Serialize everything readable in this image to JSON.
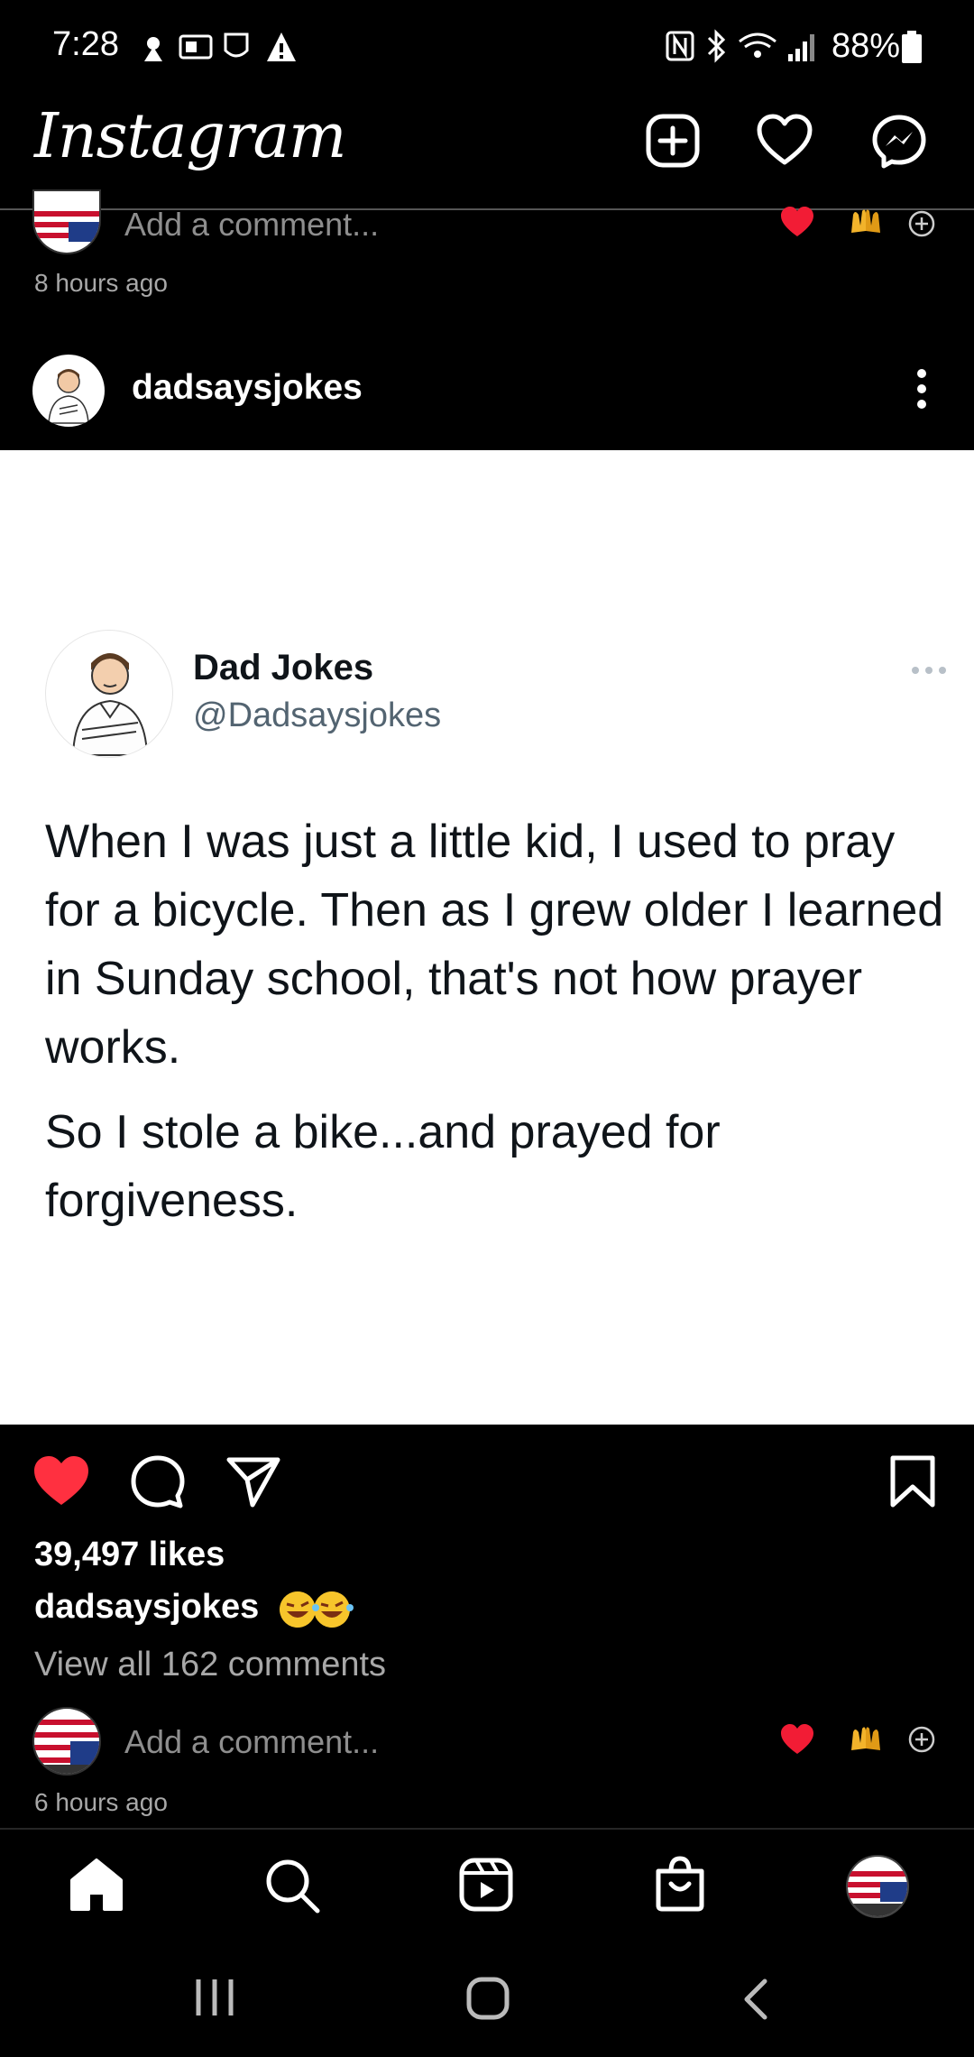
{
  "status_bar": {
    "time": "7:28",
    "battery": "88%"
  },
  "header": {
    "app_name": "Instagram",
    "icons": [
      "new-post-icon",
      "heart-icon",
      "messenger-icon"
    ]
  },
  "previous_post": {
    "comment_placeholder": "Add a comment...",
    "time_ago": "8 hours ago"
  },
  "post": {
    "username": "dadsaysjokes",
    "tweet": {
      "display_name": "Dad Jokes",
      "handle": "@Dadsaysjokes",
      "paragraph_1": "When I was just a little kid, I used to pray for a bicycle. Then as I grew older I learned in Sunday school, that's not how prayer works.",
      "paragraph_2": "So I stole a bike...and prayed for forgiveness."
    },
    "likes": "39,497 likes",
    "caption_user": "dadsaysjokes",
    "view_comments": "View all 162 comments",
    "comment_placeholder": "Add a comment...",
    "time_ago": "6 hours ago"
  },
  "bottom_nav": {
    "items": [
      "home-icon",
      "search-icon",
      "reels-icon",
      "shop-icon",
      "profile-avatar"
    ]
  },
  "colors": {
    "background": "#000000",
    "like_red": "#ff3040",
    "muted_text": "#a8a8a8"
  }
}
